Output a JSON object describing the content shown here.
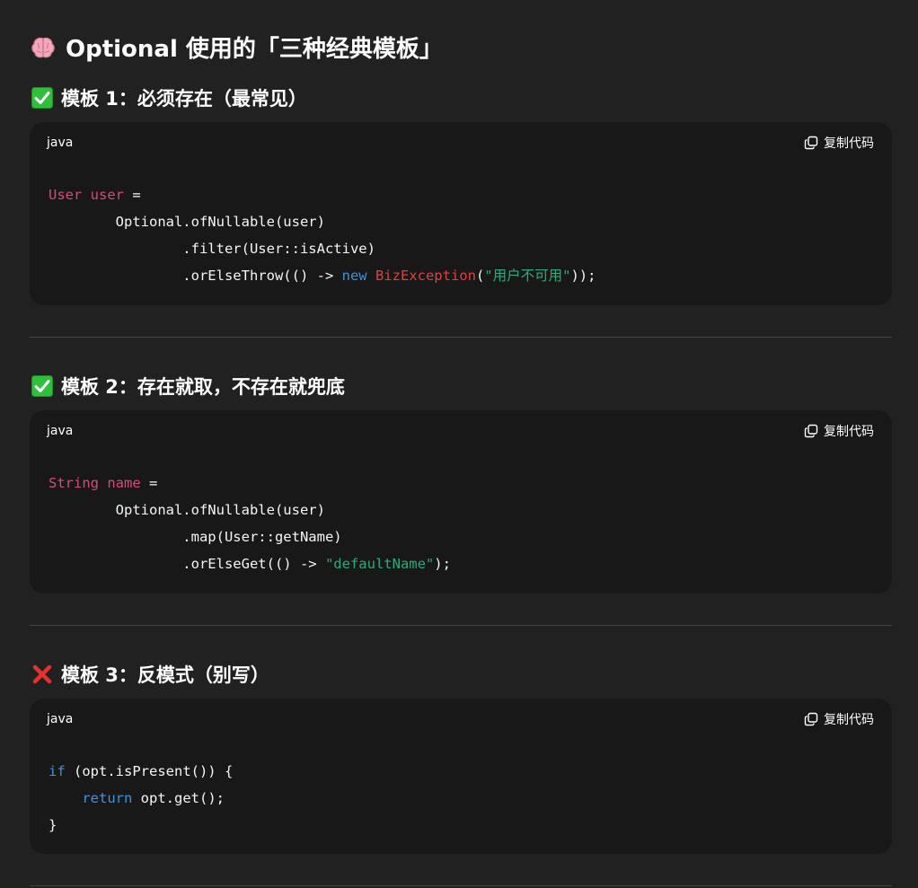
{
  "title": "Optional 使用的「三种经典模板」",
  "icons": {
    "title_icon": "brain-icon",
    "ok_icon": "check-mark-icon",
    "bad_icon": "cross-mark-icon",
    "copy_icon": "copy-icon"
  },
  "colors": {
    "background": "#212121",
    "code_background": "#181818",
    "type_keyword": "#d94a7a",
    "keyword": "#3e93e0",
    "class_name": "#e0403f",
    "string": "#2cab78"
  },
  "sections": [
    {
      "heading": "模板 1：必须存在（最常见）",
      "language": "java",
      "copy_label": "复制代码",
      "code": {
        "l1_type": "User user",
        "l1_rest": " =",
        "l2": "        Optional.ofNullable(user)",
        "l3": "                .filter(User::isActive)",
        "l4_a": "                .orElseThrow(() -> ",
        "l4_new": "new",
        "l4_sp": " ",
        "l4_cls": "BizException",
        "l4_paren": "(",
        "l4_str": "\"用户不可用\"",
        "l4_end": "));"
      }
    },
    {
      "heading": "模板 2：存在就取，不存在就兜底",
      "language": "java",
      "copy_label": "复制代码",
      "code": {
        "l1_type": "String name",
        "l1_rest": " =",
        "l2": "        Optional.ofNullable(user)",
        "l3": "                .map(User::getName)",
        "l4_a": "                .orElseGet(() -> ",
        "l4_str": "\"defaultName\"",
        "l4_end": ");"
      }
    },
    {
      "heading": "模板 3：反模式（别写）",
      "language": "java",
      "copy_label": "复制代码",
      "code": {
        "l1_kw": "if",
        "l1_rest": " (opt.isPresent()) {",
        "l2_indent": "    ",
        "l2_kw": "return",
        "l2_rest": " opt.get();",
        "l3": "}"
      }
    }
  ]
}
